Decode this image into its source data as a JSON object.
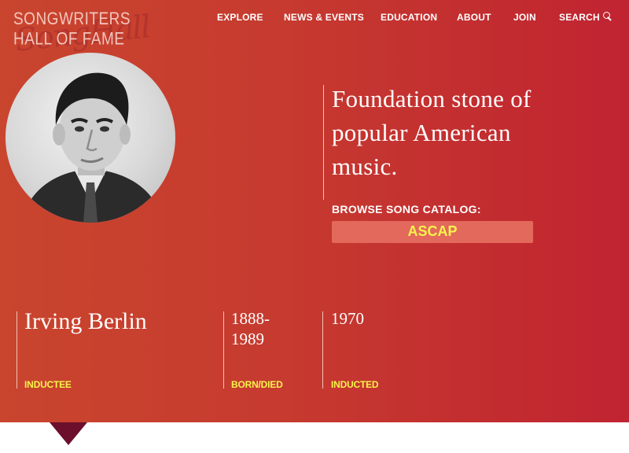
{
  "site": {
    "logo_text": "SONGWRITERS HALL OF FAME",
    "logo_script": "SongHall"
  },
  "nav": {
    "items": [
      "EXPLORE",
      "NEWS & EVENTS",
      "EDUCATION",
      "ABOUT",
      "JOIN",
      "SEARCH"
    ],
    "search_icon": "search-icon"
  },
  "profile": {
    "quote_lines": [
      "Foundation stone of",
      "popular American",
      "music."
    ],
    "browse_label": "BROWSE SONG CATALOG:",
    "catalog_button": "ASCAP",
    "name": "Irving Berlin",
    "name_label": "INDUCTEE",
    "born": "1888-",
    "died": "1989",
    "born_died_label": "BORN/DIED",
    "inducted": "1970",
    "inducted_label": "INDUCTED"
  },
  "colors": {
    "accent_yellow": "#f7f34a",
    "hero_left": "#c9452e",
    "hero_right": "#c02431",
    "button_bg": "#e2695b",
    "pointer": "#6b0f2d"
  }
}
